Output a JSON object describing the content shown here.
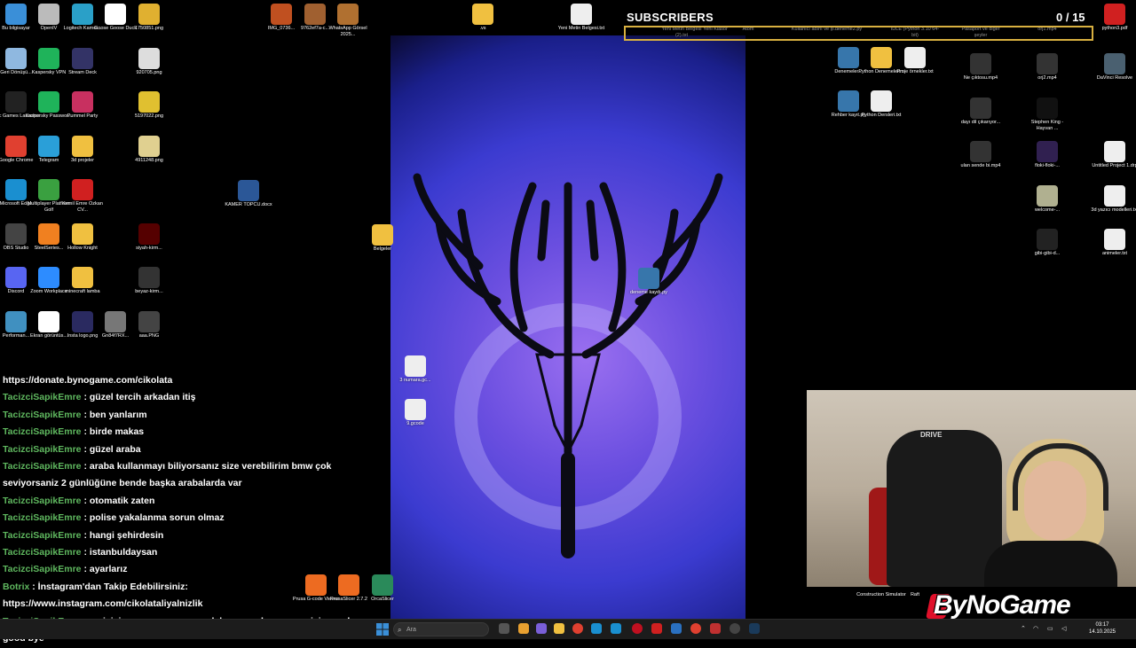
{
  "desktop": {
    "icons_left": [
      {
        "label": "Bu bilgisayar",
        "icon": "monitor-icon",
        "color": "#3a8fd8"
      },
      {
        "label": "OpenIV",
        "icon": "openiv-icon",
        "color": "#bbbbbb"
      },
      {
        "label": "Logitech Kamer...",
        "icon": "logitech-icon",
        "color": "#2aa0c8"
      },
      {
        "label": "Goose Goose Duck",
        "icon": "goose-icon",
        "color": "#ffffff"
      },
      {
        "label": "1750851.png",
        "icon": "image-icon",
        "color": "#e0b030"
      },
      {
        "label": "Geri Dönüşü...",
        "icon": "recycle-bin-icon",
        "color": "#8fb8e0"
      },
      {
        "label": "Kaspersky VPN",
        "icon": "kaspersky-vpn-icon",
        "color": "#1fb35a"
      },
      {
        "label": "Stream Deck",
        "icon": "stream-deck-icon",
        "color": "#333366"
      },
      {
        "label": "920705.png",
        "icon": "image-icon",
        "color": "#dddddd"
      },
      {
        "label": "Epic Games Launcher",
        "icon": "epic-games-icon",
        "color": "#222222"
      },
      {
        "label": "Kaspersky Passwor...",
        "icon": "kaspersky-password-icon",
        "color": "#1fb35a"
      },
      {
        "label": "Pummel Party",
        "icon": "pummel-party-icon",
        "color": "#c83060"
      },
      {
        "label": "5197022.png",
        "icon": "image-icon",
        "color": "#e0c030"
      },
      {
        "label": "Google Chrome",
        "icon": "chrome-icon",
        "color": "#e04030"
      },
      {
        "label": "Telegram",
        "icon": "telegram-icon",
        "color": "#2a9fd8"
      },
      {
        "label": "3d projeler",
        "icon": "folder-icon",
        "color": "#f0c040"
      },
      {
        "label": "4911248.png",
        "icon": "image-icon",
        "color": "#e0d090"
      },
      {
        "label": "Microsoft Edge",
        "icon": "edge-icon",
        "color": "#1a8fd0"
      },
      {
        "label": "Multiplayer Platform Golf",
        "icon": "golf-icon",
        "color": "#3aa040"
      },
      {
        "label": "Kemil Emre Özkan CV...",
        "icon": "pdf-icon",
        "color": "#d02020"
      },
      {
        "label": "OBS Studio",
        "icon": "obs-icon",
        "color": "#444444"
      },
      {
        "label": "SteelSeries...",
        "icon": "steelseries-icon",
        "color": "#f08020"
      },
      {
        "label": "Hollow Knight",
        "icon": "folder-icon",
        "color": "#f0c040"
      },
      {
        "label": "siyah-kirm...",
        "icon": "image-icon",
        "color": "#550000"
      },
      {
        "label": "Discord",
        "icon": "discord-icon",
        "color": "#5865f2"
      },
      {
        "label": "Zoom Workplace",
        "icon": "zoom-icon",
        "color": "#2d8cff"
      },
      {
        "label": "minecraft lamba",
        "icon": "folder-icon",
        "color": "#f0c040"
      },
      {
        "label": "beyaz-kirm...",
        "icon": "image-icon",
        "color": "#333333"
      },
      {
        "label": "Performan...",
        "icon": "performance-icon",
        "color": "#4090c0"
      },
      {
        "label": "Ekran görüntüs...",
        "icon": "screenshot-icon",
        "color": "#ffffff"
      },
      {
        "label": "İnsta logo.png",
        "icon": "image-icon",
        "color": "#2a2a60"
      },
      {
        "label": "Gn84f7RX...",
        "icon": "image-icon",
        "color": "#777777"
      },
      {
        "label": "aaa.PNG",
        "icon": "image-icon",
        "color": "#444444"
      }
    ],
    "icons_top_middle": [
      {
        "label": "IMG_0736...",
        "icon": "image-icon",
        "color": "#c05020"
      },
      {
        "label": "9762ef7a-c...",
        "icon": "image-icon",
        "color": "#a06030"
      },
      {
        "label": "WhatsApp Görsel 2025...",
        "icon": "image-icon",
        "color": "#b07030"
      },
      {
        "label": "KAMER TOPCU.docx",
        "icon": "word-doc-icon",
        "color": "#2b5797"
      },
      {
        "label": "Belgeler",
        "icon": "folder-icon",
        "color": "#f0c040"
      },
      {
        "label": ".vs",
        "icon": "folder-icon",
        "color": "#f0c040"
      },
      {
        "label": "Yeni Metin Belgesi.txt",
        "icon": "text-file-icon",
        "color": "#eeeeee"
      },
      {
        "label": "3 numara.gc...",
        "icon": "text-file-icon",
        "color": "#eeeeee"
      },
      {
        "label": "9.gcode",
        "icon": "text-file-icon",
        "color": "#eeeeee"
      },
      {
        "label": "deneme kaydı.py",
        "icon": "python-file-icon",
        "color": "#3776ab"
      }
    ],
    "icons_top_right_partial": [
      {
        "label": "Yeni Metin Belgesi (2).txt"
      },
      {
        "label": "Yeni Klasör"
      },
      {
        "label": "Atom"
      },
      {
        "label": "Kullanıcı adını ve şi..."
      },
      {
        "label": "deneme2.py"
      },
      {
        "label": "IDLE (Python 3.10 64-bit)"
      },
      {
        "label": "Pasaport ve diğer şeyler"
      },
      {
        "label": "orj1.mp4"
      }
    ],
    "icons_right": [
      {
        "label": "python3.pdf",
        "icon": "pdf-icon",
        "color": "#d02020"
      },
      {
        "label": "Denemeler...",
        "icon": "python-file-icon",
        "color": "#3776ab"
      },
      {
        "label": "Python Denemelerim",
        "icon": "folder-icon",
        "color": "#f0c040"
      },
      {
        "label": "Proje örnekler.txt",
        "icon": "text-file-icon",
        "color": "#eeeeee"
      },
      {
        "label": "Ne çıktosu.mp4",
        "icon": "video-icon",
        "color": "#333333"
      },
      {
        "label": "orj2.mp4",
        "icon": "video-icon",
        "color": "#333333"
      },
      {
        "label": "DaVinci Resolve",
        "icon": "davinci-icon",
        "color": "#4a6070"
      },
      {
        "label": "Rehber kayıt.py",
        "icon": "python-file-icon",
        "color": "#3776ab"
      },
      {
        "label": "Python Dersleri.txt",
        "icon": "text-file-icon",
        "color": "#eeeeee"
      },
      {
        "label": "dayı dil çıkarıyor...",
        "icon": "video-icon",
        "color": "#333333"
      },
      {
        "label": "Stephen King - Hayvan ...",
        "icon": "book-icon",
        "color": "#111111"
      },
      {
        "label": "ulan sende bi.mp4",
        "icon": "video-icon",
        "color": "#333333"
      },
      {
        "label": "floki-floki-...",
        "icon": "image-icon",
        "color": "#302050"
      },
      {
        "label": "Untitled Project 1.drp",
        "icon": "text-file-icon",
        "color": "#eeeeee"
      },
      {
        "label": "welcome-...",
        "icon": "image-icon",
        "color": "#b0b090"
      },
      {
        "label": "3d yazıcı modelleri.txt",
        "icon": "text-file-icon",
        "color": "#eeeeee"
      },
      {
        "label": "gibi-gibi-d...",
        "icon": "image-icon",
        "color": "#222222"
      },
      {
        "label": "animeler.txt",
        "icon": "text-file-icon",
        "color": "#eeeeee"
      }
    ],
    "icons_bottom_middle": [
      {
        "label": "Prusa G-code Viewer",
        "icon": "prusa-gcode-icon",
        "color": "#ed6b21"
      },
      {
        "label": "PrusaSlicer 2.7.2",
        "icon": "prusa-slicer-icon",
        "color": "#ed6b21"
      },
      {
        "label": "OrcaSlicer",
        "icon": "orca-slicer-icon",
        "color": "#2a8a5a"
      }
    ],
    "icons_bottom_right_partial": [
      {
        "label": "Construction Simulator"
      },
      {
        "label": "Raft"
      }
    ]
  },
  "overlay": {
    "subscribers_title": "SUBSCRIBERS",
    "subscribers_count": "0 / 15",
    "logo_text": "ByNoGame",
    "webcam_brand": "DRIVE"
  },
  "chat": [
    {
      "user": "",
      "message": "https://donate.bynogame.com/cikolata"
    },
    {
      "user": "TacizciSapikEmre",
      "message": " : güzel tercih arkadan itiş"
    },
    {
      "user": "TacizciSapikEmre",
      "message": " : ben yanlarım"
    },
    {
      "user": "TacizciSapikEmre",
      "message": " : birde makas"
    },
    {
      "user": "TacizciSapikEmre",
      "message": " : güzel araba"
    },
    {
      "user": "TacizciSapikEmre",
      "message": " : araba kullanmayı biliyorsanız size verebilirim bmw çok"
    },
    {
      "user": "",
      "message": "seviyorsaniz 2 günlüğüne bende başka arabalarda var"
    },
    {
      "user": "TacizciSapikEmre",
      "message": " : otomatik zaten"
    },
    {
      "user": "TacizciSapikEmre",
      "message": " : polise yakalanma sorun olmaz"
    },
    {
      "user": "TacizciSapikEmre",
      "message": " : hangi şehirdesin"
    },
    {
      "user": "TacizciSapikEmre",
      "message": " : istanbuldaysan"
    },
    {
      "user": "TacizciSapikEmre",
      "message": " : ayarlarız"
    },
    {
      "user": "Botrix",
      "message": " : İnstagram'dan Takip Edebilirsiniz:"
    },
    {
      "user": "",
      "message": "https://www.instagram.com/cikolataliyalnizlik"
    },
    {
      "user": "TacizciSapikEmre",
      "message": " : en iyisi sen oyununu oyna daha sonra konuşuruz iyi yayınlar"
    },
    {
      "user": "",
      "message": "good bye"
    }
  ],
  "taskbar": {
    "search_placeholder": "Ara",
    "time": "03:17",
    "date": "14.10.2025",
    "colors": {
      "background": "#1c1c1c",
      "start": "#3a8fd8"
    }
  }
}
